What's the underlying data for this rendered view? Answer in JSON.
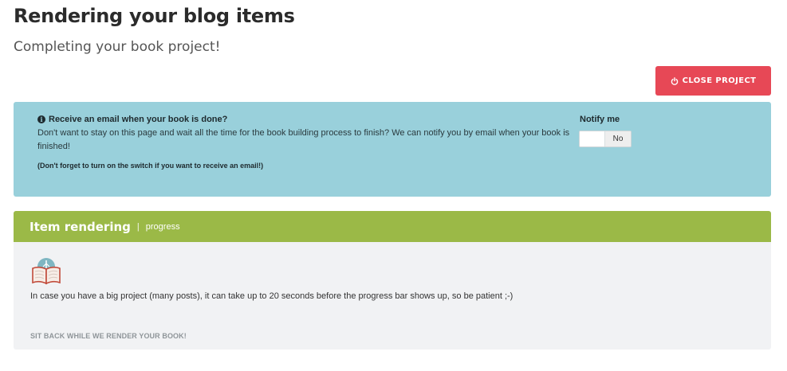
{
  "header": {
    "title": "Rendering your blog items",
    "subtitle": "Completing your book project!"
  },
  "actions": {
    "close_project_label": "CLOSE PROJECT"
  },
  "notify": {
    "heading": "Receive an email when your book is done?",
    "description": "Don't want to stay on this page and wait all the time for the book building process to finish? We can notify you by email when your book is finished!",
    "note": "(Don't forget to turn on the switch if you want to receive an email!)",
    "toggle_label": "Notify me",
    "toggle_state": "No"
  },
  "render_panel": {
    "title": "Item rendering",
    "separator": "|",
    "subtitle": "progress",
    "message": "In case you have a big project (many posts), it can take up to 20 seconds before the progress bar shows up, so be patient ;-)",
    "footer": "SIT BACK WHILE WE RENDER YOUR BOOK!"
  },
  "icons": {
    "close_button": "power-icon",
    "info": "info-icon",
    "book": "book-icon"
  },
  "colors": {
    "close_button": "#e74856",
    "info_box": "#99d0db",
    "panel_header": "#9bb947",
    "panel_body": "#f1f2f4"
  }
}
